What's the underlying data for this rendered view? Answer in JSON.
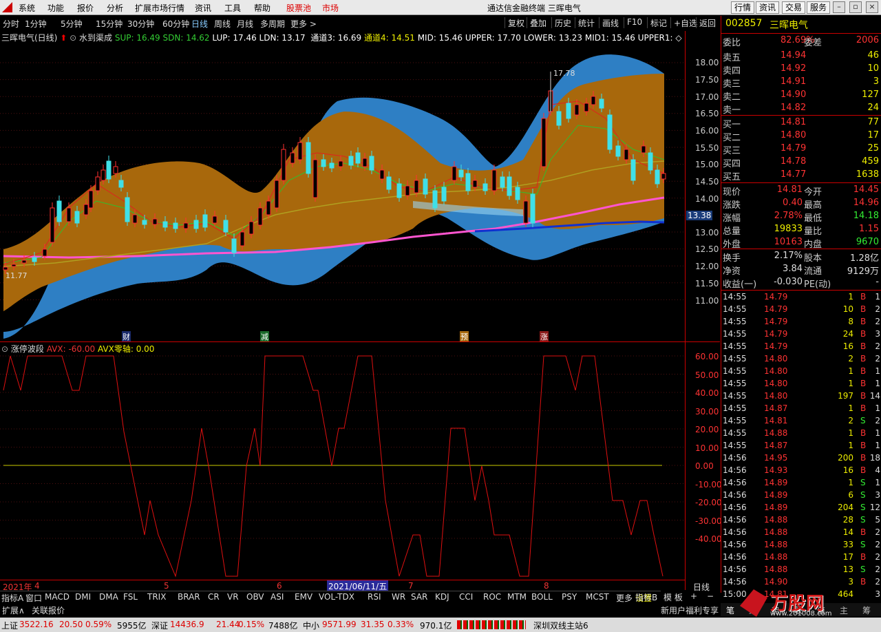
{
  "menu": {
    "items": [
      "系统",
      "功能",
      "报价",
      "分析",
      "扩展市场行情",
      "资讯",
      "工具",
      "帮助"
    ],
    "stock_pool": "股票池",
    "market": "市场",
    "title": "通达信金融终端  三晖电气",
    "right_buttons": [
      "行情",
      "资讯",
      "交易",
      "服务"
    ]
  },
  "periods": {
    "items": [
      "分时",
      "1分钟",
      "5分钟",
      "15分钟",
      "30分钟",
      "60分钟",
      "日线",
      "周线",
      "月线",
      "多周期",
      "更多 >"
    ],
    "selected": "日线",
    "tools": [
      "复权",
      "叠加",
      "历史",
      "统计",
      "画线",
      "F10",
      "标记",
      "+自选",
      "返回"
    ]
  },
  "main_chart": {
    "legend_name": "三晖电气(日线)",
    "indicator": "水到渠成",
    "sup": "SUP: 16.49",
    "sdn": "SDN: 14.62",
    "lup": "LUP: 17.46",
    "ldn": "LDN: 13.17",
    "ch3": "通道3: 16.69",
    "ch4": "通道4: 14.51",
    "mid": "MID: 15.46",
    "upper": "UPPER: 17.70",
    "lower": "LOWER: 13.23",
    "mid1": "MID1: 15.46",
    "upper1": "UPPER1: ◇",
    "high_label": "17.78",
    "low_label": "11.77",
    "price_tag": "13.38",
    "y_ticks": [
      "18.00",
      "17.50",
      "17.00",
      "16.50",
      "16.00",
      "15.50",
      "15.00",
      "14.50",
      "14.00",
      "13.50",
      "13.00",
      "12.50",
      "12.00",
      "11.50",
      "11.00"
    ],
    "events": [
      "财",
      "减",
      "预",
      "涨"
    ]
  },
  "sub_chart": {
    "name": "涨停波段",
    "avx": "AVX: -60.00",
    "avx0": "AVX零轴: 0.00",
    "y_ticks": [
      "60.00",
      "50.00",
      "40.00",
      "30.00",
      "20.00",
      "10.00",
      "0.00",
      "-10.00",
      "-20.00",
      "-30.00",
      "-40.00"
    ]
  },
  "x_axis": {
    "labels": [
      "2021年",
      "4",
      "5",
      "6",
      "2021/06/11/五",
      "7",
      "8"
    ],
    "right": "日线"
  },
  "indicator_tabs": [
    "指标A",
    "窗口",
    "MACD",
    "DMI",
    "DMA",
    "FSL",
    "TRIX",
    "BRAR",
    "CR",
    "VR",
    "OBV",
    "ASI",
    "EMV",
    "VOL-TDX",
    "RSI",
    "WR",
    "SAR",
    "KDJ",
    "CCI",
    "ROC",
    "MTM",
    "BOLL",
    "PSY",
    "MCST",
    "更多",
    "设置"
  ],
  "indicator_b": "指标B",
  "template": "模 板",
  "ext_tabs": [
    "扩展∧",
    "关联报价"
  ],
  "promo": "新用户福利专享",
  "right_panel": {
    "code": "002857",
    "name": "三晖电气",
    "weibi_label": "委比",
    "weibi": "82.69%",
    "weicha_label": "委差",
    "weicha": "2006",
    "asks": [
      {
        "label": "卖五",
        "price": "14.94",
        "vol": "46"
      },
      {
        "label": "卖四",
        "price": "14.92",
        "vol": "10"
      },
      {
        "label": "卖三",
        "price": "14.91",
        "vol": "3"
      },
      {
        "label": "卖二",
        "price": "14.90",
        "vol": "127"
      },
      {
        "label": "卖一",
        "price": "14.82",
        "vol": "24"
      }
    ],
    "bids": [
      {
        "label": "买一",
        "price": "14.81",
        "vol": "77"
      },
      {
        "label": "买二",
        "price": "14.80",
        "vol": "17"
      },
      {
        "label": "买三",
        "price": "14.79",
        "vol": "25"
      },
      {
        "label": "买四",
        "price": "14.78",
        "vol": "459"
      },
      {
        "label": "买五",
        "price": "14.77",
        "vol": "1638"
      }
    ],
    "quote": [
      {
        "l1": "现价",
        "v1": "14.81",
        "l2": "今开",
        "v2": "14.45"
      },
      {
        "l1": "涨跌",
        "v1": "0.40",
        "l2": "最高",
        "v2": "14.96"
      },
      {
        "l1": "涨幅",
        "v1": "2.78%",
        "l2": "最低",
        "v2": "14.18"
      },
      {
        "l1": "总量",
        "v1": "19833",
        "l2": "量比",
        "v2": "1.15"
      },
      {
        "l1": "外盘",
        "v1": "10163",
        "l2": "内盘",
        "v2": "9670"
      }
    ],
    "fund": [
      {
        "l1": "换手",
        "v1": "2.17%",
        "l2": "股本",
        "v2": "1.28亿"
      },
      {
        "l1": "净资",
        "v1": "3.84",
        "l2": "流通",
        "v2": "9129万"
      },
      {
        "l1": "收益(一)",
        "v1": "-0.030",
        "l2": "PE(动)",
        "v2": "-"
      }
    ],
    "ticks": [
      {
        "t": "14:55",
        "p": "14.79",
        "v": "1",
        "s": "B",
        "n": "1"
      },
      {
        "t": "14:55",
        "p": "14.79",
        "v": "10",
        "s": "B",
        "n": "2"
      },
      {
        "t": "14:55",
        "p": "14.79",
        "v": "8",
        "s": "B",
        "n": "2"
      },
      {
        "t": "14:55",
        "p": "14.79",
        "v": "24",
        "s": "B",
        "n": "3"
      },
      {
        "t": "14:55",
        "p": "14.79",
        "v": "16",
        "s": "B",
        "n": "2"
      },
      {
        "t": "14:55",
        "p": "14.80",
        "v": "2",
        "s": "B",
        "n": "2"
      },
      {
        "t": "14:55",
        "p": "14.80",
        "v": "1",
        "s": "B",
        "n": "1"
      },
      {
        "t": "14:55",
        "p": "14.80",
        "v": "1",
        "s": "B",
        "n": "1"
      },
      {
        "t": "14:55",
        "p": "14.80",
        "v": "197",
        "s": "B",
        "n": "14"
      },
      {
        "t": "14:55",
        "p": "14.87",
        "v": "1",
        "s": "B",
        "n": "1"
      },
      {
        "t": "14:55",
        "p": "14.81",
        "v": "2",
        "s": "S",
        "n": "2"
      },
      {
        "t": "14:55",
        "p": "14.88",
        "v": "1",
        "s": "B",
        "n": "1"
      },
      {
        "t": "14:55",
        "p": "14.87",
        "v": "1",
        "s": "B",
        "n": "1"
      },
      {
        "t": "14:56",
        "p": "14.95",
        "v": "200",
        "s": "B",
        "n": "18"
      },
      {
        "t": "14:56",
        "p": "14.93",
        "v": "16",
        "s": "B",
        "n": "4"
      },
      {
        "t": "14:56",
        "p": "14.89",
        "v": "1",
        "s": "S",
        "n": "1"
      },
      {
        "t": "14:56",
        "p": "14.89",
        "v": "6",
        "s": "S",
        "n": "3"
      },
      {
        "t": "14:56",
        "p": "14.89",
        "v": "204",
        "s": "S",
        "n": "12"
      },
      {
        "t": "14:56",
        "p": "14.88",
        "v": "28",
        "s": "S",
        "n": "5"
      },
      {
        "t": "14:56",
        "p": "14.88",
        "v": "14",
        "s": "B",
        "n": "2"
      },
      {
        "t": "14:56",
        "p": "14.88",
        "v": "33",
        "s": "S",
        "n": "2"
      },
      {
        "t": "14:56",
        "p": "14.88",
        "v": "17",
        "s": "B",
        "n": "2"
      },
      {
        "t": "14:56",
        "p": "14.88",
        "v": "13",
        "s": "S",
        "n": "2"
      },
      {
        "t": "14:56",
        "p": "14.90",
        "v": "3",
        "s": "B",
        "n": "2"
      },
      {
        "t": "15:00",
        "p": "14.81",
        "v": "464",
        "s": "",
        "n": "3"
      }
    ],
    "bottom_tabs": [
      "笔",
      "细",
      "势",
      "联",
      "值",
      "主",
      "筹"
    ]
  },
  "status": {
    "sh_label": "上证",
    "sh": "3522.16",
    "sh_chg": "20.50",
    "sh_pct": "0.59%",
    "sh_amt": "5955亿",
    "sz_label": "深证",
    "sz": "14436.9",
    "sz_chg": "21.44",
    "sz_pct": "0.15%",
    "sz_amt": "7488亿",
    "zx_label": "中小",
    "zx": "9571.99",
    "zx_chg": "31.35",
    "zx_pct": "0.33%",
    "zx_amt": "970.1亿",
    "server": "深圳双线主站6"
  },
  "watermark": "万股网",
  "watermark_url": "www.201008.com"
}
